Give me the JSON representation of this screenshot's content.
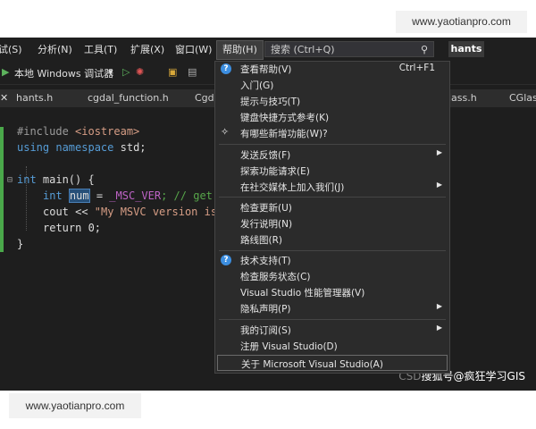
{
  "watermark": {
    "top": "www.yaotianpro.com",
    "bottom": "www.yaotianpro.com"
  },
  "menubar": {
    "items": [
      "试(S)",
      "分析(N)",
      "工具(T)",
      "扩展(X)",
      "窗口(W)",
      "帮助(H)"
    ],
    "search_placeholder": "搜索 (Ctrl+Q)",
    "search_icon": "search-icon",
    "brand": "hants"
  },
  "toolbar": {
    "run_label": "本地 Windows 调试器",
    "dropdown_arrow": "▾",
    "play_icon": "▶"
  },
  "tabs": [
    "hants.h",
    "cgdal_function.h",
    "Cgd",
    "lass.h",
    "CGlass"
  ],
  "code": {
    "line1_pre": "#include ",
    "line1_inc": "<iostream>",
    "line2_kw1": "using",
    "line2_kw2": "namespace",
    "line2_rest": " std;",
    "line4_kw": "int",
    "line4_rest": " main() {",
    "line5_kw": "int",
    "line5_var": "num",
    "line5_eq": " = ",
    "line5_mac": "_MSC_VER",
    "line5_cm": "; // get",
    "line6_pre": "cout << ",
    "line6_str": "\"My MSVC version is",
    "line7": "return 0;",
    "line8": "}"
  },
  "help_menu": {
    "items": [
      {
        "label": "查看帮助(V)",
        "shortcut": "Ctrl+F1",
        "icon": "help-circle-icon"
      },
      {
        "label": "入门(G)"
      },
      {
        "label": "提示与技巧(T)"
      },
      {
        "label": "键盘快捷方式参考(K)"
      },
      {
        "label": "有哪些新增功能(W)?",
        "icon": "sparkle-icon"
      },
      {
        "label": "发送反馈(F)",
        "submenu": true
      },
      {
        "label": "探索功能请求(E)"
      },
      {
        "label": "在社交媒体上加入我们(J)",
        "submenu": true
      },
      {
        "label": "检查更新(U)"
      },
      {
        "label": "发行说明(N)"
      },
      {
        "label": "路线图(R)"
      },
      {
        "label": "技术支持(T)",
        "icon": "help-circle-icon"
      },
      {
        "label": "检查服务状态(C)"
      },
      {
        "label": "Visual Studio 性能管理器(V)"
      },
      {
        "label": "隐私声明(P)",
        "submenu": true
      },
      {
        "label": "我的订阅(S)",
        "submenu": true
      },
      {
        "label": "注册 Visual Studio(D)"
      },
      {
        "label": "关于 Microsoft Visual Studio(A)"
      }
    ]
  },
  "credit": {
    "prefix": "CSD",
    "text": "搜狐号@疯狂学习GIS"
  }
}
